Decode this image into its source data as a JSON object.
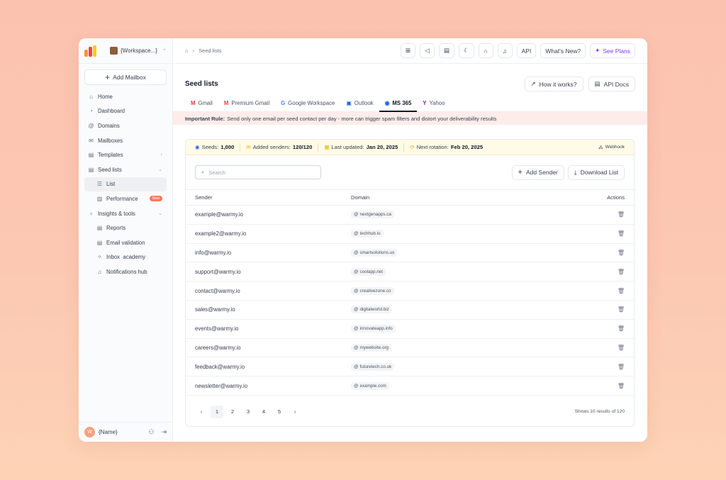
{
  "workspace": {
    "name": "{Workspace...}"
  },
  "sidebar": {
    "add_mailbox": "Add Mailbox",
    "items": [
      {
        "label": "Home"
      },
      {
        "label": "Dashboard"
      },
      {
        "label": "Domains"
      },
      {
        "label": "Mailboxes"
      },
      {
        "label": "Templates"
      },
      {
        "label": "Seed lists"
      },
      {
        "label": "List"
      },
      {
        "label": "Performance",
        "badge": "New"
      },
      {
        "label": "Insights & tools"
      },
      {
        "label": "Reports"
      },
      {
        "label": "Email validation"
      },
      {
        "label": "Inbox  academy"
      },
      {
        "label": "Notifications hub"
      }
    ],
    "user": {
      "initial": "W",
      "name": "{Name}"
    }
  },
  "topbar": {
    "breadcrumb": "Seed lists",
    "api": "API",
    "whats_new": "What's New?",
    "see_plans": "See Plans"
  },
  "page": {
    "title": "Seed lists",
    "how_it_works": "How it works?",
    "api_docs": "API Docs"
  },
  "tabs": [
    "Gmail",
    "Premium Gmail",
    "Google Workspace",
    "Outlook",
    "MS 365",
    "Yahoo"
  ],
  "rule": {
    "label": "Important Rule:",
    "text": "Send only one email per seed contact per day - more can trigger spam filters and distort your deliverability results"
  },
  "stats": {
    "seeds_label": "Seeds:",
    "seeds": "1,000",
    "senders_label": "Added senders:",
    "senders": "120/120",
    "updated_label": "Last updated:",
    "updated": "Jan 20, 2025",
    "rotation_label": "Next rotation:",
    "rotation": "Feb 20, 2025",
    "webhook": "Webhook"
  },
  "toolbar": {
    "search_placeholder": "Search",
    "add_sender": "Add Sender",
    "download": "Download List"
  },
  "table": {
    "headers": {
      "sender": "Sender",
      "domain": "Domain",
      "actions": "Actions"
    },
    "rows": [
      {
        "sender": "example@warmy.io",
        "domain": "nextgenapps.ca"
      },
      {
        "sender": "example2@warmy.io",
        "domain": "techhub.io"
      },
      {
        "sender": "info@warmy.io",
        "domain": "smartsolutions.us"
      },
      {
        "sender": "support@warmy.io",
        "domain": "coolapp.net"
      },
      {
        "sender": "contact@warmy.io",
        "domain": "creativezone.co"
      },
      {
        "sender": "sales@warmy.io",
        "domain": "digitalworld.biz"
      },
      {
        "sender": "events@warmy.io",
        "domain": "innovateapp.info"
      },
      {
        "sender": "careers@warmy.io",
        "domain": "mywebsite.org"
      },
      {
        "sender": "feedback@warmy.io",
        "domain": "futuretech.co.uk"
      },
      {
        "sender": "newsletter@warmy.io",
        "domain": "example.com"
      }
    ]
  },
  "pagination": {
    "prev": "‹",
    "pages": [
      "1",
      "2",
      "3",
      "4",
      "5"
    ],
    "next": "›",
    "current": "1",
    "summary": "Shows 10 results of 120"
  },
  "colors": {
    "accent": "#7c3aed",
    "rule_bg": "#fdecea",
    "stats_bg": "#fffbe6"
  }
}
